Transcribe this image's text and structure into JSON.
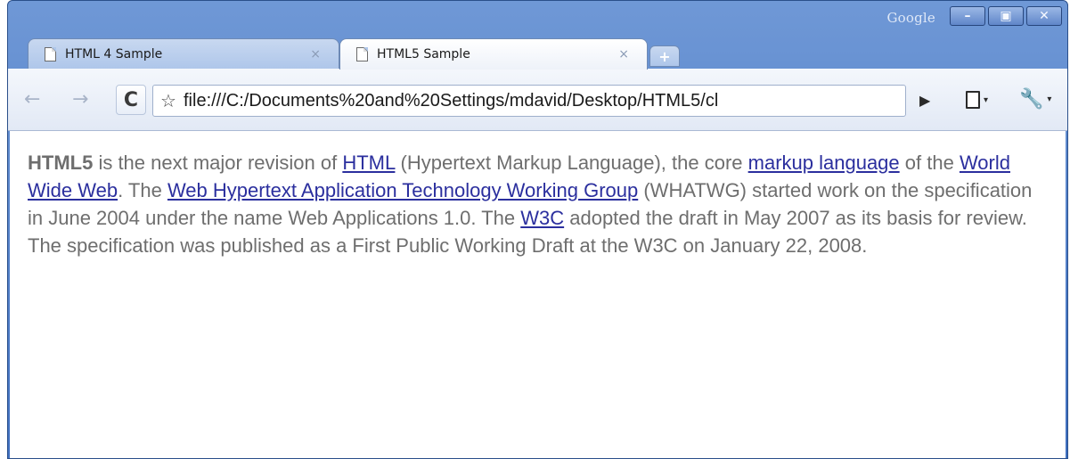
{
  "window": {
    "brand": "Google",
    "controls": {
      "minimize": "–",
      "maximize": "▣",
      "close": "✕"
    }
  },
  "tabs": [
    {
      "label": "HTML 4 Sample",
      "close": "×"
    },
    {
      "label": "HTML5 Sample",
      "close": "×"
    }
  ],
  "new_tab": "+",
  "toolbar": {
    "back": "←",
    "forward": "→",
    "reload": "C",
    "star": "☆",
    "url": "file:///C:/Documents%20and%20Settings/mdavid/Desktop/HTML5/cl",
    "go": "▶",
    "caret": "▾",
    "wrench": "🔧"
  },
  "content": {
    "p1_bold": "HTML5",
    "p1_t1": " is the next major revision of ",
    "link_html": "HTML",
    "p1_t2": " (Hypertext Markup Language), the core ",
    "link_markup": "markup language",
    "p1_t3": " of the ",
    "link_www": "World Wide Web",
    "p1_t4": ". The ",
    "link_whatwg": "Web Hypertext Application Technology Working Group",
    "p1_t5": " (WHATWG) started work on the specification in June 2004 under the name Web Applications 1.0. The ",
    "link_w3c": "W3C",
    "p1_t6": " adopted the draft in May 2007 as its basis for review. The specification was published as a First Public Working Draft at the W3C on January 22, 2008."
  }
}
